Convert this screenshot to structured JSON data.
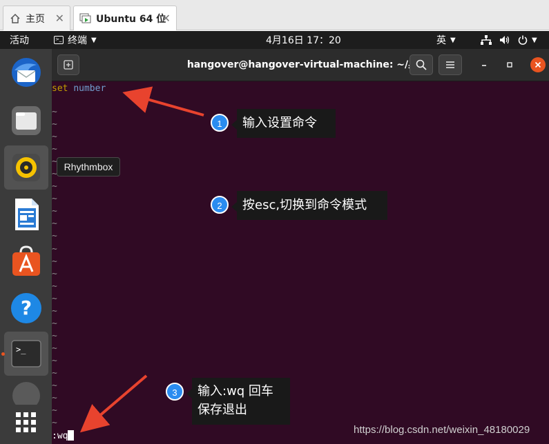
{
  "vm_tabs": [
    {
      "label": "主页",
      "icon": "home-icon"
    },
    {
      "label": "Ubuntu 64 位",
      "icon": "vm-icon"
    }
  ],
  "topbar": {
    "activities": "活动",
    "app_menu": "终端",
    "clock": "4月16日  17：20",
    "input_method": "英"
  },
  "dock": {
    "tooltip": "Rhythmbox",
    "apps": [
      "Thunderbird",
      "Files",
      "Rhythmbox",
      "LibreOffice Writer",
      "Ubuntu Software",
      "Help",
      "Terminal",
      "Show Applications"
    ]
  },
  "terminal": {
    "title": "hangover@hangover-virtual-machine: ~/桌面",
    "cmd_keyword": "set",
    "cmd_arg": "number",
    "tilde": "~",
    "tilde_count": 26,
    "status_line": ":wq"
  },
  "annotations": [
    {
      "number": "1",
      "text": "输入设置命令"
    },
    {
      "number": "2",
      "text": "按esc,切换到命令模式"
    },
    {
      "number": "3",
      "line1": "输入:wq 回车",
      "line2": "保存退出"
    }
  ],
  "watermark": "https://blog.csdn.net/weixin_48180029",
  "colors": {
    "terminal_bg": "#300a24",
    "dock_bg": "#3b3b3b",
    "accent": "#e95420",
    "arrow": "#e8432e",
    "badge": "#2a8cf0"
  }
}
